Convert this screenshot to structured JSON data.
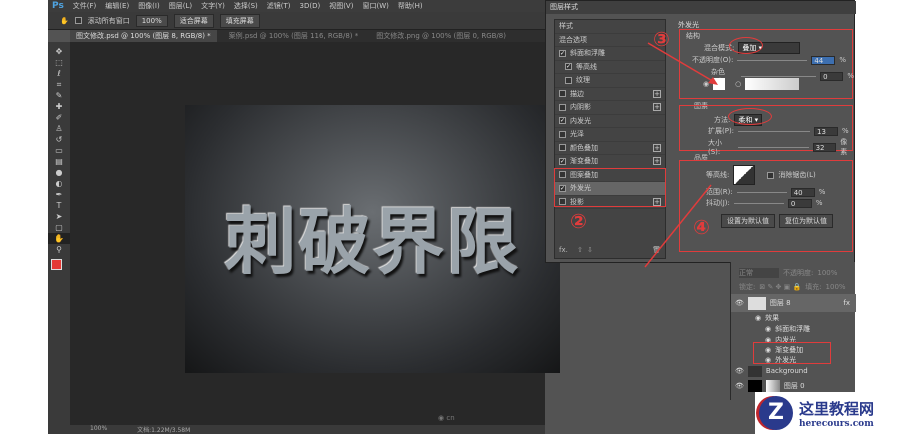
{
  "menubar": {
    "app_logo": "Ps",
    "items": [
      "文件(F)",
      "编辑(E)",
      "图像(I)",
      "图层(L)",
      "文字(Y)",
      "选择(S)",
      "滤镜(T)",
      "3D(D)",
      "视图(V)",
      "窗口(W)",
      "帮助(H)"
    ]
  },
  "options": {
    "scroll_all": "滚动所有窗口",
    "zoom": "100%",
    "fit_screen": "适合屏幕",
    "fill_screen": "填充屏幕"
  },
  "tabs": [
    "图文修改.psd @ 100% (图层 8, RGB/8) *",
    "案例.psd @ 100% (图层 116, RGB/8) *",
    "图文修改.png @ 100% (图层 0, RGB/8)"
  ],
  "artwork": {
    "text": "刺破界限"
  },
  "status": {
    "zoom": "100%",
    "doc": "文档:1.22M/3.58M"
  },
  "watermark": "cn",
  "dialog": {
    "title": "图层样式",
    "styles_header": "样式",
    "blend_options": "混合选项",
    "items": [
      {
        "label": "斜面和浮雕",
        "checked": true,
        "plus": false
      },
      {
        "label": "等高线",
        "checked": true,
        "plus": false
      },
      {
        "label": "纹理",
        "checked": false,
        "plus": false
      },
      {
        "label": "描边",
        "checked": false,
        "plus": true
      },
      {
        "label": "内阴影",
        "checked": false,
        "plus": true
      },
      {
        "label": "内发光",
        "checked": true,
        "plus": false
      },
      {
        "label": "光泽",
        "checked": false,
        "plus": false
      },
      {
        "label": "颜色叠加",
        "checked": false,
        "plus": true
      },
      {
        "label": "渐变叠加",
        "checked": true,
        "plus": true
      },
      {
        "label": "图案叠加",
        "checked": false,
        "plus": false
      },
      {
        "label": "外发光",
        "checked": true,
        "plus": false
      },
      {
        "label": "投影",
        "checked": false,
        "plus": true
      }
    ],
    "fx": "fx.",
    "panel_title": "外发光",
    "structure": {
      "title": "结构",
      "blend_mode_label": "混合模式:",
      "blend_mode": "叠加",
      "opacity_label": "不透明度(O):",
      "opacity": "44",
      "noise_label": "杂色(N):",
      "noise": "0",
      "pct": "%"
    },
    "elements": {
      "title": "图素",
      "method_label": "方法:",
      "method": "柔和",
      "spread_label": "扩展(P):",
      "spread": "13",
      "size_label": "大小(S):",
      "size": "32",
      "px": "像素"
    },
    "quality": {
      "title": "品质",
      "contour_label": "等高线:",
      "antialias": "消除锯齿(L)",
      "range_label": "范围(R):",
      "range": "40",
      "jitter_label": "抖动(J):",
      "jitter": "0",
      "set_default": "设置为默认值",
      "reset_default": "复位为默认值"
    },
    "annotations": [
      "③",
      "②",
      "④"
    ]
  },
  "layers": {
    "mode": "正常",
    "opacity_label": "不透明度:",
    "opacity": "100%",
    "lock_label": "锁定:",
    "fill_label": "填充:",
    "fill": "100%",
    "rows": [
      {
        "name": "图层 8",
        "fx": "fx"
      },
      {
        "name": "效果"
      },
      {
        "name": "斜面和浮雕"
      },
      {
        "name": "内发光"
      },
      {
        "name": "渐变叠加"
      },
      {
        "name": "外发光"
      },
      {
        "name": "Background"
      },
      {
        "name": "图层 0"
      }
    ]
  },
  "site": {
    "name": "这里教程网",
    "url": "herecours.com"
  },
  "colors": {
    "accent_red": "#e03c3c",
    "fg_swatch": "#e53935"
  }
}
